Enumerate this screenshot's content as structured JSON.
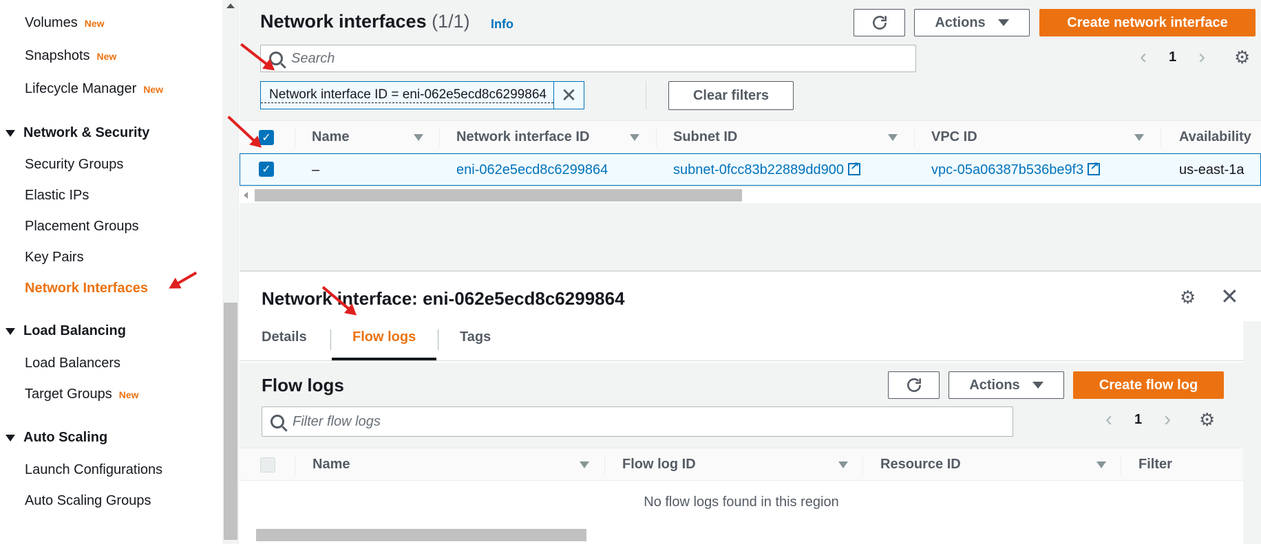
{
  "sidebar": {
    "items": [
      {
        "label": "Volumes",
        "badge": "New"
      },
      {
        "label": "Snapshots",
        "badge": "New"
      },
      {
        "label": "Lifecycle Manager",
        "badge": "New"
      }
    ],
    "network_security": {
      "section_label": "Network & Security",
      "items": [
        "Security Groups",
        "Elastic IPs",
        "Placement Groups",
        "Key Pairs",
        "Network Interfaces"
      ],
      "active": "Network Interfaces"
    },
    "load_balancing": {
      "section_label": "Load Balancing",
      "items": [
        {
          "label": "Load Balancers",
          "badge": ""
        },
        {
          "label": "Target Groups",
          "badge": "New"
        }
      ]
    },
    "auto_scaling": {
      "section_label": "Auto Scaling",
      "items": [
        "Launch Configurations",
        "Auto Scaling Groups"
      ]
    }
  },
  "main": {
    "title": "Network interfaces",
    "count": "(1/1)",
    "info": "Info",
    "actions_label": "Actions",
    "create_label": "Create network interface",
    "search_placeholder": "Search",
    "page": "1",
    "filter_token": "Network interface ID = eni-062e5ecd8c6299864",
    "clear_filters": "Clear filters",
    "columns": [
      "Name",
      "Network interface ID",
      "Subnet ID",
      "VPC ID",
      "Availability"
    ],
    "row": {
      "name": "–",
      "eni_id": "eni-062e5ecd8c6299864",
      "subnet_id": "subnet-0fcc83b22889dd900",
      "vpc_id": "vpc-05a06387b536be9f3",
      "az": "us-east-1a"
    }
  },
  "detail": {
    "title": "Network interface: eni-062e5ecd8c6299864",
    "tabs": [
      "Details",
      "Flow logs",
      "Tags"
    ],
    "active_tab": "Flow logs",
    "flow_logs": {
      "title": "Flow logs",
      "actions_label": "Actions",
      "create_label": "Create flow log",
      "filter_placeholder": "Filter flow logs",
      "page": "1",
      "columns": [
        "Name",
        "Flow log ID",
        "Resource ID",
        "Filter"
      ],
      "empty_message": "No flow logs found in this region"
    }
  },
  "colors": {
    "accent": "#ec7211",
    "link": "#0073bb",
    "annotation": "#e02020"
  },
  "icons": [
    "refresh-icon",
    "gear-icon",
    "close-icon",
    "search-icon",
    "external-link-icon",
    "chevron-left-icon",
    "chevron-right-icon",
    "sort-icon",
    "checkbox-icon",
    "arrow-annotation"
  ]
}
